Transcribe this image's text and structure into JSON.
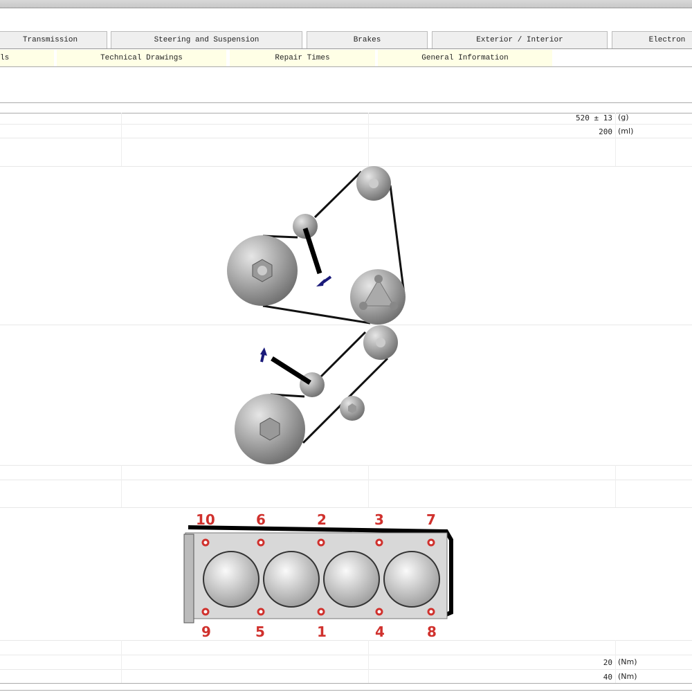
{
  "tabs": [
    "Transmission",
    "Steering and Suspension",
    "Brakes",
    "Exterior / Interior",
    "Electron"
  ],
  "subtabs": [
    "ls",
    "Technical Drawings",
    "Repair Times",
    "General Information"
  ],
  "rows": [
    {
      "value": "520 ± 13",
      "unit": "(g)"
    },
    {
      "value": "200",
      "unit": "(ml)"
    },
    {
      "value": "20",
      "unit": "(Nm)"
    },
    {
      "value": "40",
      "unit": "(Nm)"
    }
  ],
  "tightening_sequence": {
    "top": [
      "10",
      "6",
      "2",
      "3",
      "7"
    ],
    "bottom": [
      "9",
      "5",
      "1",
      "4",
      "8"
    ]
  },
  "colors": {
    "arrow": "#1a1a7a",
    "sequence": "#d0312d",
    "subtab_bg": "#ffffe6"
  }
}
